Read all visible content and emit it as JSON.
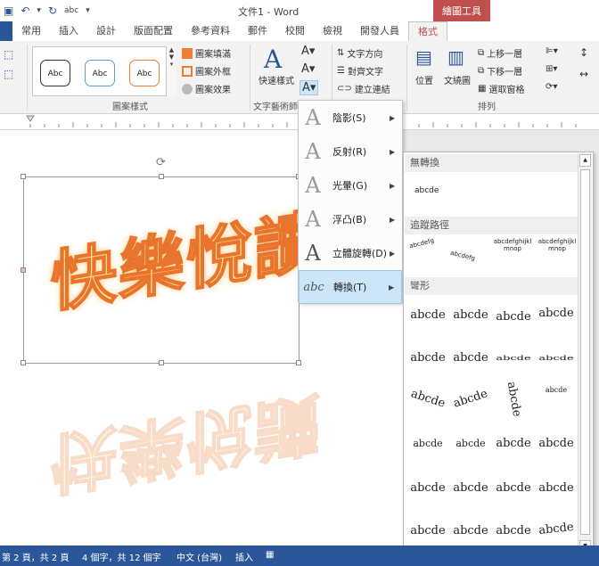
{
  "window": {
    "title": "文件1 - Word",
    "contextual_group": "繪圖工具",
    "qat_font_preview": "abc"
  },
  "tabs": [
    "常用",
    "插入",
    "設計",
    "版面配置",
    "參考資料",
    "郵件",
    "校閱",
    "檢視",
    "開發人員",
    "格式"
  ],
  "active_tab": "格式",
  "ribbon": {
    "shape_styles": {
      "label": "圖案樣式",
      "samples": [
        "Abc",
        "Abc",
        "Abc"
      ],
      "fill": "圖案填滿",
      "outline": "圖案外框",
      "effects": "圖案效果"
    },
    "wordart": {
      "label": "文字藝術師",
      "quick_styles": "快速樣式"
    },
    "text": {
      "direction": "文字方向",
      "align": "對齊文字",
      "link": "建立連結"
    },
    "arrange": {
      "label": "排列",
      "position": "位置",
      "wrap": "文繞圖",
      "forward": "上移一層",
      "backward": "下移一層",
      "selection_pane": "選取窗格"
    }
  },
  "text_effects_menu": [
    {
      "label": "陰影(S)",
      "icon": "A"
    },
    {
      "label": "反射(R)",
      "icon": "A"
    },
    {
      "label": "光暈(G)",
      "icon": "A"
    },
    {
      "label": "浮凸(B)",
      "icon": "A"
    },
    {
      "label": "立體旋轉(D)",
      "icon": "A"
    },
    {
      "label": "轉換(T)",
      "icon": "abc"
    }
  ],
  "transform_submenu": {
    "no_transform_header": "無轉換",
    "no_transform_sample": "abcde",
    "follow_path_header": "追蹤路徑",
    "path_samples": [
      "abcdefg",
      "abcdefg",
      "abcdefghijklmnop",
      "abcdefghijklmnop"
    ],
    "warp_header": "彎形",
    "warp_sample": "abcde"
  },
  "document": {
    "wordart_text": "快樂悅讀"
  },
  "status": {
    "page": "第 2 頁，共 2 頁",
    "words": "4 個字，共 12 個字",
    "language": "中文 (台灣)",
    "mode": "插入"
  },
  "colors": {
    "accent": "#2b579a",
    "contextual": "#c0504d",
    "art_fill": "#ffe89a",
    "art_stroke": "#e8742e"
  }
}
